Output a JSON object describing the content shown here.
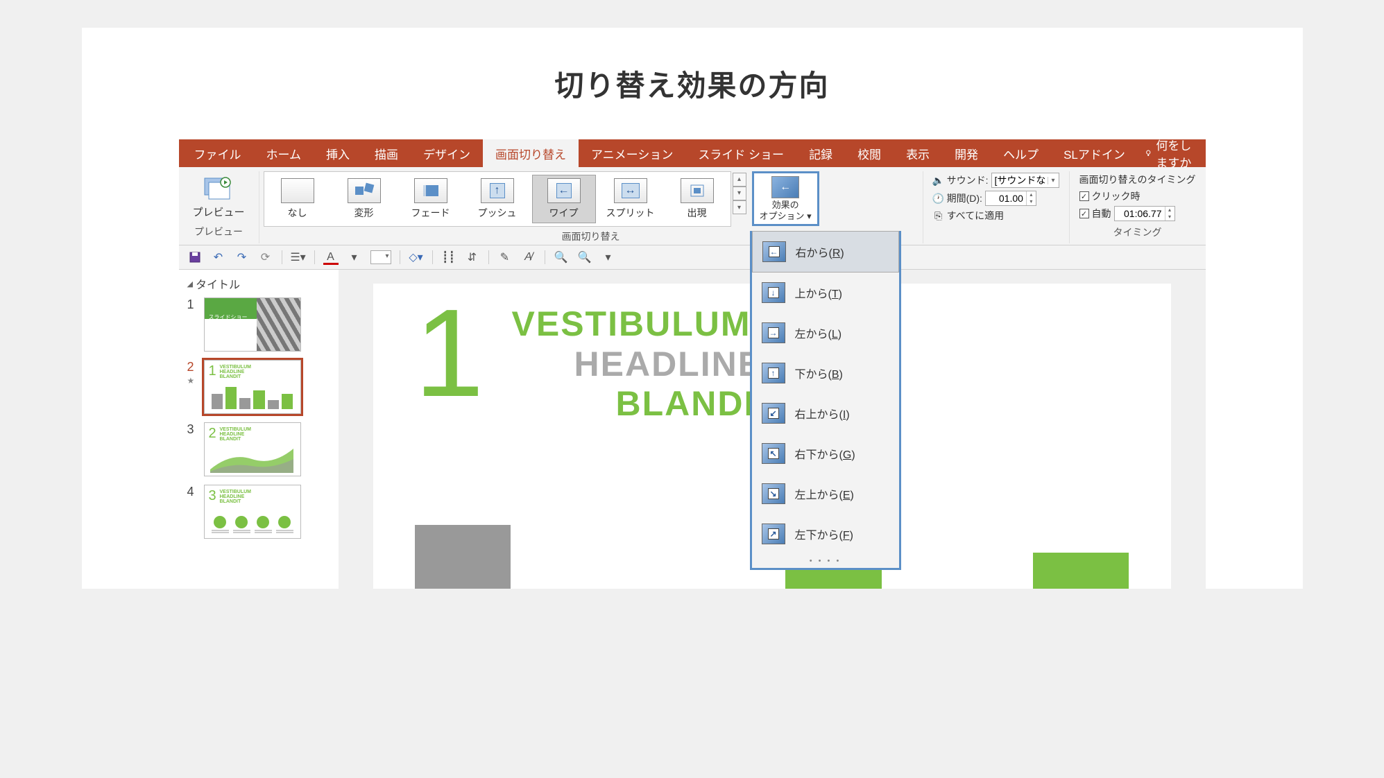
{
  "page_title": "切り替え効果の方向",
  "ribbon": {
    "tabs": [
      "ファイル",
      "ホーム",
      "挿入",
      "描画",
      "デザイン",
      "画面切り替え",
      "アニメーション",
      "スライド ショー",
      "記録",
      "校閲",
      "表示",
      "開発",
      "ヘルプ",
      "SLアドイン"
    ],
    "active_tab": "画面切り替え",
    "tell_me": "何をしますか"
  },
  "preview": {
    "button": "プレビュー",
    "group": "プレビュー"
  },
  "transitions": {
    "items": [
      {
        "label": "なし",
        "icon": "none"
      },
      {
        "label": "変形",
        "icon": "morph"
      },
      {
        "label": "フェード",
        "icon": "fade"
      },
      {
        "label": "プッシュ",
        "icon": "push"
      },
      {
        "label": "ワイプ",
        "icon": "wipe",
        "selected": true
      },
      {
        "label": "スプリット",
        "icon": "split"
      },
      {
        "label": "出現",
        "icon": "appear"
      }
    ],
    "group_label": "画面切り替え",
    "effect_options": "効果の\nオプション ▾"
  },
  "dropdown": {
    "items": [
      {
        "label_pre": "右から(",
        "key": "R",
        "label_post": ")",
        "arrow": "←",
        "selected": true
      },
      {
        "label_pre": "上から(",
        "key": "T",
        "label_post": ")",
        "arrow": "↓"
      },
      {
        "label_pre": "左から(",
        "key": "L",
        "label_post": ")",
        "arrow": "→"
      },
      {
        "label_pre": "下から(",
        "key": "B",
        "label_post": ")",
        "arrow": "↑"
      },
      {
        "label_pre": "右上から(",
        "key": "I",
        "label_post": ")",
        "arrow": "↙"
      },
      {
        "label_pre": "右下から(",
        "key": "G",
        "label_post": ")",
        "arrow": "↖"
      },
      {
        "label_pre": "左上から(",
        "key": "E",
        "label_post": ")",
        "arrow": "↘"
      },
      {
        "label_pre": "左下から(",
        "key": "F",
        "label_post": ")",
        "arrow": "↗"
      }
    ]
  },
  "timing": {
    "sound_label": "サウンド:",
    "sound_value": "[サウンドなし]",
    "duration_label": "期間(D):",
    "duration_value": "01.00",
    "apply_all": "すべてに適用",
    "group_label": "タイミング",
    "advance_title": "画面切り替えのタイミング",
    "on_click": "クリック時",
    "auto_label": "自動",
    "auto_value": "01:06.77"
  },
  "outline": {
    "header": "タイトル"
  },
  "thumbs": [
    {
      "num": "1",
      "title": "スライドショー\nタイトル"
    },
    {
      "num": "2",
      "active": true
    },
    {
      "num": "3"
    },
    {
      "num": "4"
    }
  ],
  "slide": {
    "number": "1",
    "line1": "VESTIBULUM",
    "line2": "HEADLINE",
    "line3": "BLANDIT"
  }
}
